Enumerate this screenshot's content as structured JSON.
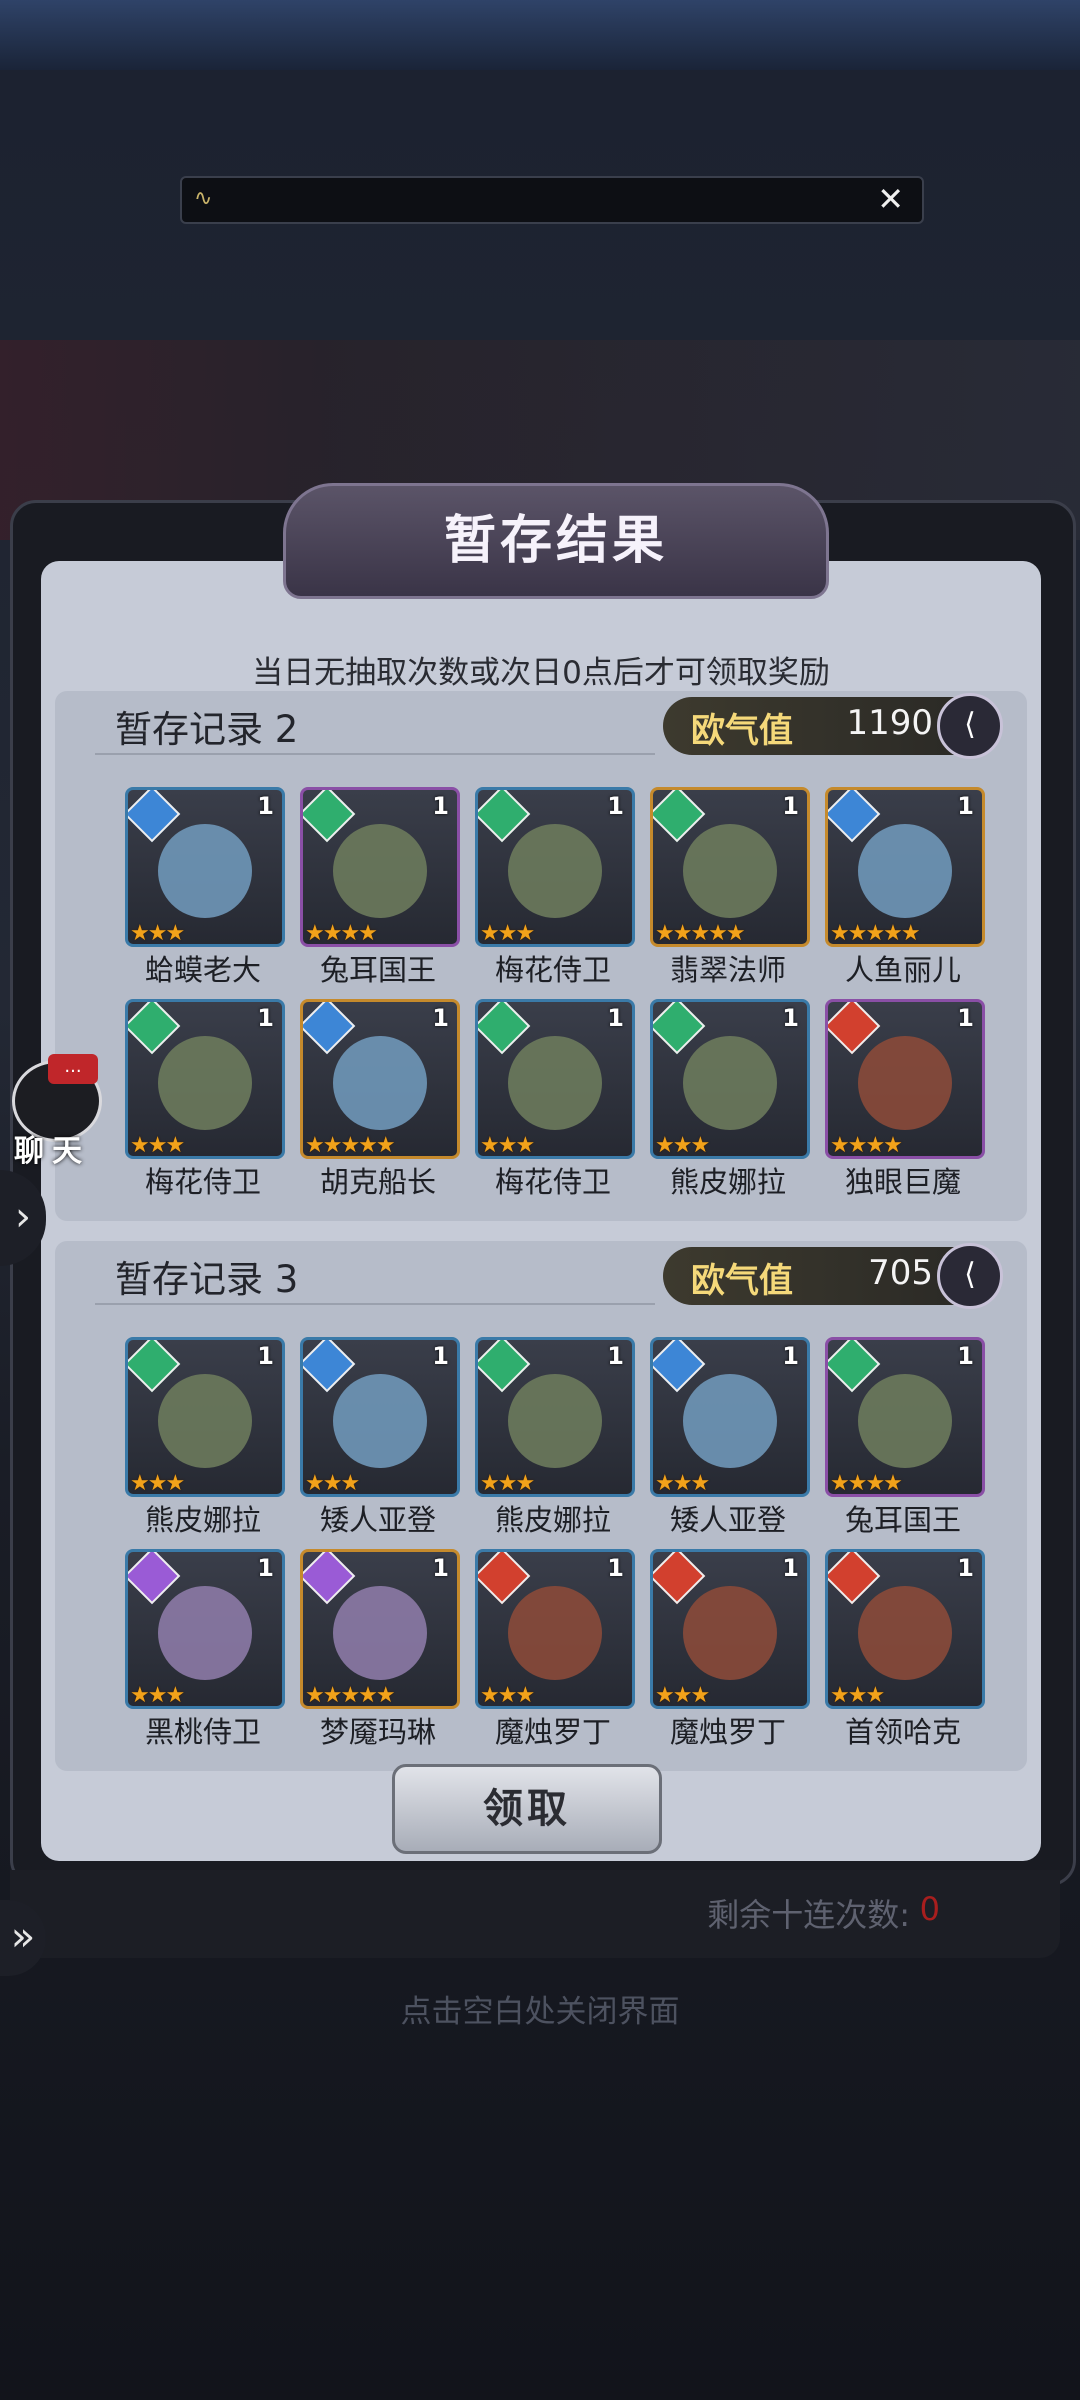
{
  "top_bar": {
    "close_symbol": "✕"
  },
  "panel": {
    "title": "暂存结果",
    "subtitle": "当日无抽取次数或次日0点后才可领取奖励"
  },
  "sections": [
    {
      "title": "暂存记录 2",
      "luck_label": "欧气值",
      "luck_value": "1190",
      "heroes": [
        {
          "name": "蛤蟆老大",
          "count": "1",
          "stars": "★★★",
          "element": "water",
          "frame": "#3a7aa8"
        },
        {
          "name": "兔耳国王",
          "count": "1",
          "stars": "★★★★",
          "element": "nature",
          "frame": "#8a4fa6"
        },
        {
          "name": "梅花侍卫",
          "count": "1",
          "stars": "★★★",
          "element": "nature",
          "frame": "#3a7aa8"
        },
        {
          "name": "翡翠法师",
          "count": "1",
          "stars": "★★★★★",
          "element": "nature",
          "frame": "#c58a2c"
        },
        {
          "name": "人鱼丽儿",
          "count": "1",
          "stars": "★★★★★",
          "element": "water",
          "frame": "#c58a2c"
        },
        {
          "name": "梅花侍卫",
          "count": "1",
          "stars": "★★★",
          "element": "nature",
          "frame": "#3a7aa8"
        },
        {
          "name": "胡克船长",
          "count": "1",
          "stars": "★★★★★",
          "element": "water",
          "frame": "#c58a2c"
        },
        {
          "name": "梅花侍卫",
          "count": "1",
          "stars": "★★★",
          "element": "nature",
          "frame": "#3a7aa8"
        },
        {
          "name": "熊皮娜拉",
          "count": "1",
          "stars": "★★★",
          "element": "nature",
          "frame": "#3a7aa8"
        },
        {
          "name": "独眼巨魔",
          "count": "1",
          "stars": "★★★★",
          "element": "fire",
          "frame": "#8a4fa6"
        }
      ]
    },
    {
      "title": "暂存记录 3",
      "luck_label": "欧气值",
      "luck_value": "705",
      "heroes": [
        {
          "name": "熊皮娜拉",
          "count": "1",
          "stars": "★★★",
          "element": "nature",
          "frame": "#3a7aa8"
        },
        {
          "name": "矮人亚登",
          "count": "1",
          "stars": "★★★",
          "element": "water",
          "frame": "#3a7aa8"
        },
        {
          "name": "熊皮娜拉",
          "count": "1",
          "stars": "★★★",
          "element": "nature",
          "frame": "#3a7aa8"
        },
        {
          "name": "矮人亚登",
          "count": "1",
          "stars": "★★★",
          "element": "water",
          "frame": "#3a7aa8"
        },
        {
          "name": "兔耳国王",
          "count": "1",
          "stars": "★★★★",
          "element": "nature",
          "frame": "#8a4fa6"
        },
        {
          "name": "黑桃侍卫",
          "count": "1",
          "stars": "★★★",
          "element": "moon",
          "frame": "#3a7aa8"
        },
        {
          "name": "梦魇玛琳",
          "count": "1",
          "stars": "★★★★★",
          "element": "moon",
          "frame": "#c58a2c"
        },
        {
          "name": "魔烛罗丁",
          "count": "1",
          "stars": "★★★",
          "element": "fire",
          "frame": "#3a7aa8"
        },
        {
          "name": "魔烛罗丁",
          "count": "1",
          "stars": "★★★",
          "element": "fire",
          "frame": "#3a7aa8"
        },
        {
          "name": "首领哈克",
          "count": "1",
          "stars": "★★★",
          "element": "fire",
          "frame": "#3a7aa8"
        }
      ]
    }
  ],
  "claim_label": "领取",
  "remain_label": "剩余十连次数:",
  "remain_value": "0",
  "close_hint": "点击空白处关闭界面",
  "chat": {
    "label": "聊天",
    "badge": "..."
  },
  "element_colors": {
    "water": "#3d86d6",
    "nature": "#2fae6e",
    "fire": "#d2402e",
    "moon": "#9a5bd6"
  }
}
